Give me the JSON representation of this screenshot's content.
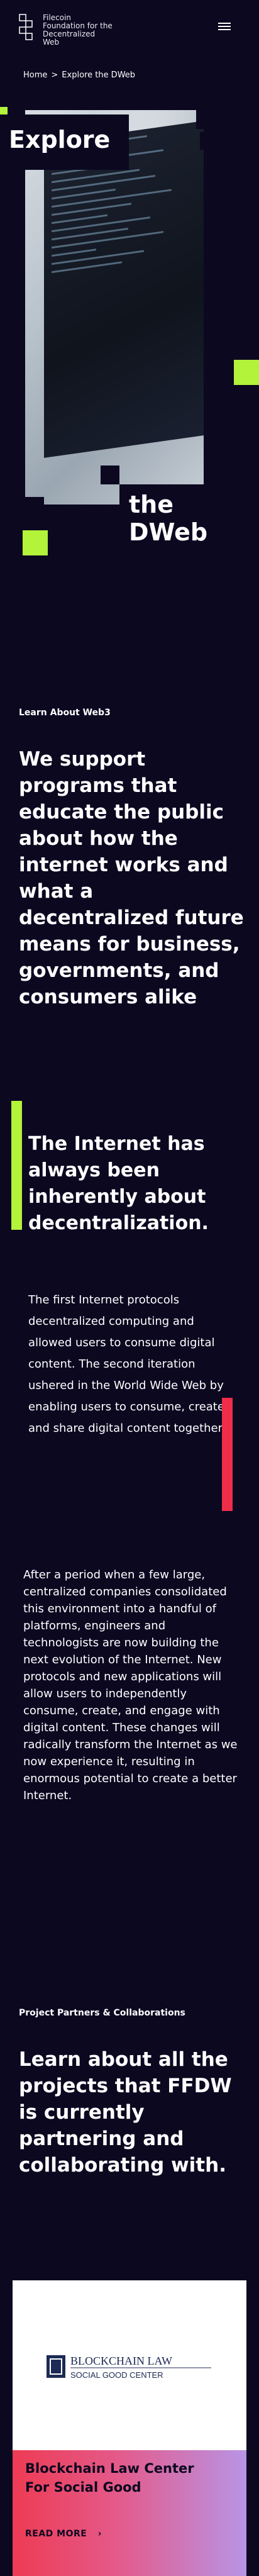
{
  "header": {
    "brand_lines": [
      "Filecoin",
      "Foundation for the",
      "Decentralized",
      "Web"
    ],
    "menu_icon": "hamburger-icon"
  },
  "breadcrumb": {
    "home": "Home",
    "separator": ">",
    "current": "Explore the DWeb"
  },
  "hero": {
    "title_part1": "Explore",
    "title_part2": "the DWeb",
    "accent_color": "#b3f33a"
  },
  "learn_section": {
    "eyebrow": "Learn About Web3",
    "statement": "We support programs that educate the public about how the internet works and what a decentralized future means for business, governments, and consumers alike"
  },
  "internet_section": {
    "heading": "The Internet has always been inherently about decentralization.",
    "paragraph_1": "The first Internet protocols decentralized computing and allowed users to consume digital content. The second iteration ushered in the World Wide Web by enabling users to consume, create and share digital content together.",
    "paragraph_2": "After a period when a few large, centralized companies consolidated this environment into a handful of platforms, engineers and technologists are now building the next evolution of the Internet. New protocols and new applications will allow users to independently consume, create, and engage with digital content. These changes will radically transform the Internet as we now experience it, resulting in enormous potential to create a better Internet.",
    "colors": {
      "lime": "#b3f33a",
      "red": "#ef2d49"
    }
  },
  "partners_section": {
    "eyebrow": "Project Partners & Collaborations",
    "heading": "Learn about all the projects that FFDW is currently partnering and collaborating with."
  },
  "partner_card": {
    "logo_line1": "BLOCKCHAIN LAW",
    "logo_line2": "SOCIAL GOOD CENTER",
    "title": "Blockchain Law Center For Social Good",
    "cta": "READ MORE",
    "cta_icon": "chevron-right-icon"
  }
}
